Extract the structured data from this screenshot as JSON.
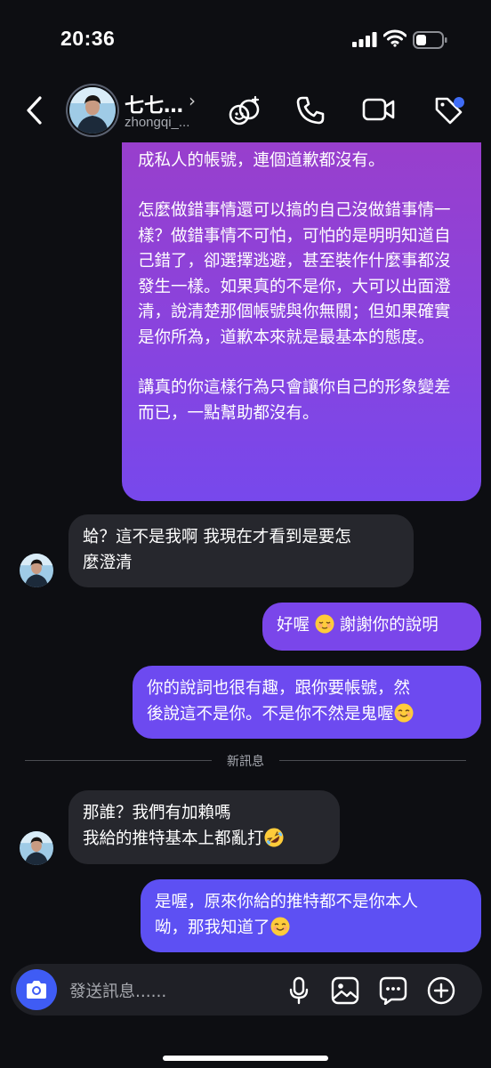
{
  "status_bar": {
    "time": "20:36"
  },
  "header": {
    "name": "七七…",
    "chevron": "›",
    "username": "zhongqi_...",
    "icons": [
      "effects-icon",
      "phone-icon",
      "video-icon",
      "tag-icon"
    ]
  },
  "messages": [
    {
      "direction": "outgoing",
      "paragraphs": [
        "之前的內容都刪除，換了大頭照跟名字，改成私人的帳號，連個道歉都沒有。",
        "怎麼做錯事情還可以搞的自己沒做錯事情一樣？做錯事情不可怕，可怕的是明明知道自己錯了，卻選擇逃避，甚至裝作什麼事都沒發生一樣。如果真的不是你，大可以出面澄清，說清楚那個帳號與你無關；但如果確實是你所為，道歉本來就是最基本的態度。",
        "講真的你這樣行為只會讓你自己的形象變差而已，一點幫助都沒有。"
      ]
    },
    {
      "direction": "incoming",
      "lines": [
        "蛤？這不是我啊 我現在才看到是要怎",
        "麼澄清"
      ]
    },
    {
      "direction": "outgoing",
      "text_before": "好喔",
      "emoji": "relieved-face",
      "text_after": " 謝謝你的說明"
    },
    {
      "direction": "outgoing",
      "lines": [
        "你的說詞也很有趣，跟你要帳號，然",
        "後說這不是你。不是你不然是鬼喔"
      ],
      "emoji": "smiling-face"
    },
    {
      "direction": "incoming",
      "lines": [
        "那誰？我們有加賴嗎",
        "我給的推特基本上都亂打"
      ],
      "emoji": "rolling-laughing-face"
    },
    {
      "direction": "outgoing",
      "lines": [
        "是喔，原來你給的推特都不是你本人",
        "呦，那我知道了"
      ],
      "emoji": "smiling-face"
    }
  ],
  "divider": {
    "label": "新訊息"
  },
  "composer": {
    "placeholder": "發送訊息......"
  },
  "colors": {
    "background": "#0d0e12",
    "incoming_bubble": "#26272d",
    "outgoing_purple": "#9b3ec9",
    "outgoing_blue": "#6b4cf3",
    "camera_button": "#3f5cf5"
  }
}
